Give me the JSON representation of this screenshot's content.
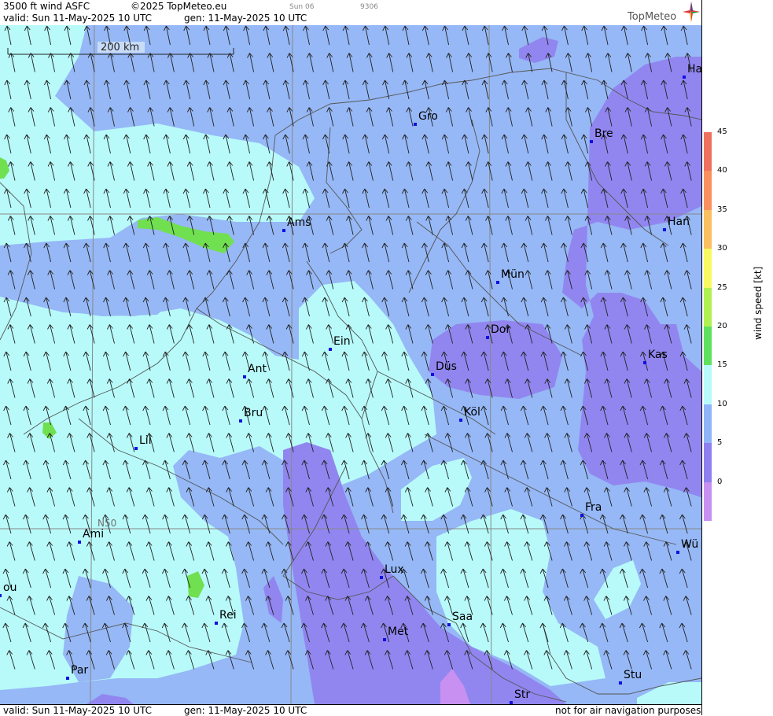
{
  "header": {
    "product": "3500 ft wind ASFC",
    "copyright": "©2025 TopMeteo.eu",
    "valid": "valid:  Sun  11-May-2025  10 UTC",
    "gen": "gen: 11-May-2025 10 UTC",
    "small1": "Sun 06",
    "small2": "9306",
    "logo": "TopMeteo"
  },
  "footer": {
    "valid": "valid:  Sun  11-May-2025  10 UTC",
    "gen": "gen: 11-May-2025 10 UTC",
    "disclaimer": "not for air navigation purposes"
  },
  "map": {
    "scale_label": "200 km",
    "lat_label": "N50",
    "cities": [
      "Ha",
      "Gro",
      "Bre",
      "Ams",
      "Han",
      "Mün",
      "Ein",
      "Dor",
      "Kas",
      "Ant",
      "Düs",
      "Bru",
      "Köl",
      "Lil",
      "Fra",
      "Ami",
      "Wü",
      "Lux",
      "ou",
      "Rei",
      "Saa",
      "Met",
      "Par",
      "Stu",
      "Str"
    ]
  },
  "legend": {
    "unit_label": "wind  speed  [kt]",
    "ticks": [
      "45",
      "40",
      "35",
      "30",
      "25",
      "20",
      "15",
      "10",
      "5",
      "0"
    ],
    "colors": [
      "#c890f0",
      "#8f80f0",
      "#8fb4f8",
      "#b8fafa",
      "#60e060",
      "#b0f050",
      "#f8f860",
      "#f8c060",
      "#f89060",
      "#f07060"
    ]
  },
  "colors": {
    "bg_medium": "#96b8f6",
    "light": "#b8fafa",
    "purple": "#9186f0",
    "green": "#70e050",
    "violet": "#c890f0"
  }
}
